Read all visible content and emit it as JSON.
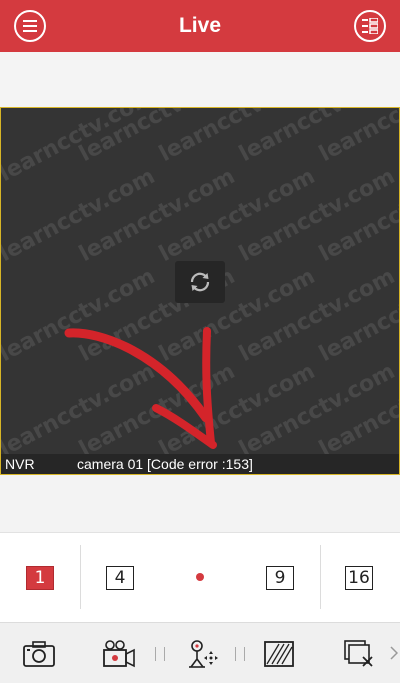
{
  "header": {
    "title": "Live",
    "menu_icon": "hamburger-menu-icon",
    "device_list_icon": "device-list-icon",
    "background_color": "#d43a3f"
  },
  "video": {
    "watermark": "learncctv.com",
    "device_name": "NVR",
    "status_message": "camera 01 [Code error :153]",
    "refresh_icon": "refresh-icon",
    "annotation_icon": "red-arrow-annotation",
    "border_color": "#d7b526"
  },
  "layout_selector": {
    "options": [
      "1",
      "4",
      "9",
      "16"
    ],
    "selected": "1",
    "page_indicator_icon": "page-dot-icon"
  },
  "toolbar": {
    "items": [
      "camera-snapshot-icon",
      "record-video-icon",
      "ptz-control-icon",
      "image-quality-icon",
      "close-all-icon"
    ],
    "more_icon": "chevron-right-icon"
  }
}
